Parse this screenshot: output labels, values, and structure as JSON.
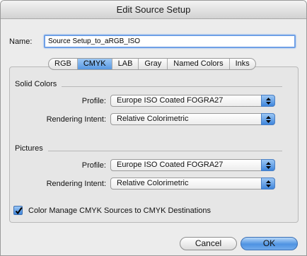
{
  "window": {
    "title": "Edit Source Setup"
  },
  "name_field": {
    "label": "Name:",
    "value": "Source Setup_to_aRGB_ISO"
  },
  "tabs": [
    {
      "label": "RGB",
      "active": false
    },
    {
      "label": "CMYK",
      "active": true
    },
    {
      "label": "LAB",
      "active": false
    },
    {
      "label": "Gray",
      "active": false
    },
    {
      "label": "Named Colors",
      "active": false
    },
    {
      "label": "Inks",
      "active": false
    }
  ],
  "solid_colors": {
    "heading": "Solid Colors",
    "profile_label": "Profile:",
    "profile_value": "Europe ISO Coated FOGRA27",
    "intent_label": "Rendering Intent:",
    "intent_value": "Relative Colorimetric"
  },
  "pictures": {
    "heading": "Pictures",
    "profile_label": "Profile:",
    "profile_value": "Europe ISO Coated FOGRA27",
    "intent_label": "Rendering Intent:",
    "intent_value": "Relative Colorimetric"
  },
  "color_manage": {
    "checked": true,
    "label": "Color Manage CMYK Sources to CMYK Destinations"
  },
  "buttons": {
    "cancel": "Cancel",
    "ok": "OK"
  },
  "colors": {
    "accent": "#4f92e0",
    "focus_ring": "#6fa0e6"
  }
}
